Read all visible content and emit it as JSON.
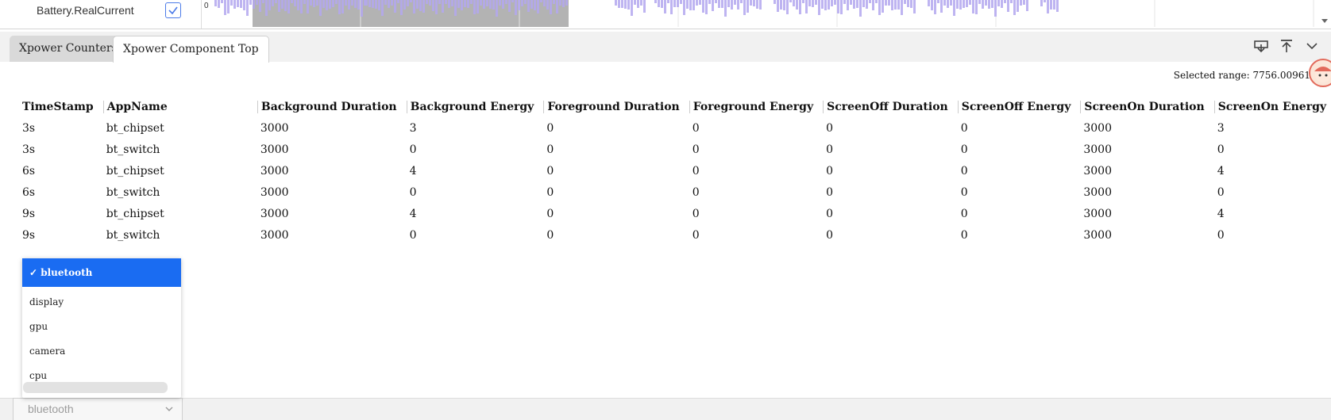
{
  "trace": {
    "label": "Battery.RealCurrent",
    "checked": true,
    "axis_zero": "0",
    "accent": "#b3a7ef",
    "selection_color": "#b3b3b3"
  },
  "tabs": [
    {
      "label": "Xpower Counters",
      "active": false
    },
    {
      "label": "Xpower Component Top",
      "active": true
    }
  ],
  "toolbar_icons": [
    "download-icon",
    "pin-top-icon",
    "chevron-down-icon"
  ],
  "selected_range": "Selected range: 7756.00961",
  "table": {
    "columns": [
      "TimeStamp",
      "AppName",
      "Background Duration",
      "Background Energy",
      "Foreground Duration",
      "Foreground Energy",
      "ScreenOff Duration",
      "ScreenOff Energy",
      "ScreenOn Duration",
      "ScreenOn Energy"
    ],
    "rows": [
      [
        "3s",
        "bt_chipset",
        "3000",
        "3",
        "0",
        "0",
        "0",
        "0",
        "3000",
        "3"
      ],
      [
        "3s",
        "bt_switch",
        "3000",
        "0",
        "0",
        "0",
        "0",
        "0",
        "3000",
        "0"
      ],
      [
        "6s",
        "bt_chipset",
        "3000",
        "4",
        "0",
        "0",
        "0",
        "0",
        "3000",
        "4"
      ],
      [
        "6s",
        "bt_switch",
        "3000",
        "0",
        "0",
        "0",
        "0",
        "0",
        "3000",
        "0"
      ],
      [
        "9s",
        "bt_chipset",
        "3000",
        "4",
        "0",
        "0",
        "0",
        "0",
        "3000",
        "4"
      ],
      [
        "9s",
        "bt_switch",
        "3000",
        "0",
        "0",
        "0",
        "0",
        "0",
        "3000",
        "0"
      ]
    ]
  },
  "dropdown": {
    "options": [
      "bluetooth",
      "display",
      "gpu",
      "camera",
      "cpu"
    ],
    "selected": "bluetooth",
    "selected_color": "#1a6cf2"
  },
  "select": {
    "value": "bluetooth"
  }
}
